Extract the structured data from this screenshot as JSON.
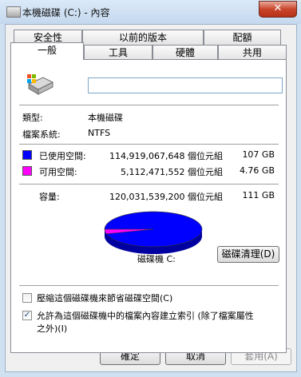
{
  "window": {
    "title": "本機磁碟 (C:) - 內容",
    "close_glyph": "✕"
  },
  "tabs_row1": [
    {
      "label": "安全性"
    },
    {
      "label": "以前的版本"
    },
    {
      "label": "配額"
    }
  ],
  "tabs_row2": [
    {
      "label": "一般"
    },
    {
      "label": "工具"
    },
    {
      "label": "硬體"
    },
    {
      "label": "共用"
    }
  ],
  "general": {
    "drive_icon": "drive-icon",
    "name_value": "",
    "type_label": "類型:",
    "type_value": "本機磁碟",
    "fs_label": "檔案系統:",
    "fs_value": "NTFS",
    "used": {
      "label": "已使用空間:",
      "bytes": "114,919,067,648 個位元組",
      "size": "107 GB",
      "color": "#0000ff"
    },
    "free": {
      "label": "可用空間:",
      "bytes": "5,112,471,552 個位元組",
      "size": "4.76 GB",
      "color": "#ff00ff"
    },
    "capacity": {
      "label": "容量:",
      "bytes": "120,031,539,200 個位元組",
      "size": "111 GB"
    },
    "drive_label": "磁碟機 C:",
    "cleanup_button": "磁碟清理(D)",
    "compress_label": "壓縮這個磁碟機來節省磁碟空間(C)",
    "compress_checked": false,
    "index_label_line1": "允許為這個磁碟機中的檔案內容建立索引 (除了檔案屬性",
    "index_label_line2": "之外)(I)",
    "index_checked": true,
    "check_glyph": "✓"
  },
  "chart_data": {
    "type": "pie",
    "values": [
      114919067648,
      5112471552
    ],
    "labels": [
      "已使用空間",
      "可用空間"
    ],
    "colors": [
      "#0000ff",
      "#ff00ff"
    ]
  },
  "buttons": {
    "ok": "確定",
    "cancel": "取消",
    "apply": "套用(A)"
  }
}
